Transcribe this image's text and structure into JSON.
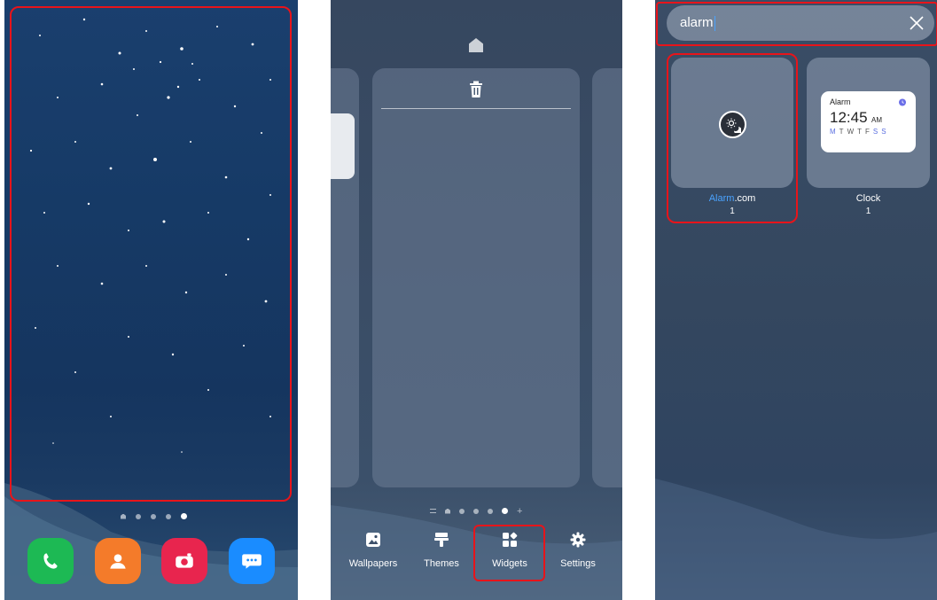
{
  "panel1": {
    "page_indicator_count": 5,
    "dock_apps": [
      {
        "name": "phone-icon",
        "color": "#1db954"
      },
      {
        "name": "contacts-icon",
        "color": "#f47b2a"
      },
      {
        "name": "camera-icon",
        "color": "#e8254e"
      },
      {
        "name": "messages-icon",
        "color": "#1a8cff"
      }
    ]
  },
  "panel2": {
    "menu": {
      "wallpapers": "Wallpapers",
      "themes": "Themes",
      "widgets": "Widgets",
      "settings": "Settings"
    }
  },
  "panel3": {
    "search": {
      "value": "alarm"
    },
    "results": [
      {
        "name_highlight": "Alarm",
        "name_rest": ".com",
        "count": "1"
      },
      {
        "name": "Clock",
        "count": "1"
      }
    ],
    "clock_widget": {
      "title": "Alarm",
      "time": "12:45",
      "ampm": "AM",
      "days": [
        "M",
        "T",
        "W",
        "T",
        "F",
        "S",
        "S"
      ]
    },
    "accent_color": "#4aa3ff"
  }
}
